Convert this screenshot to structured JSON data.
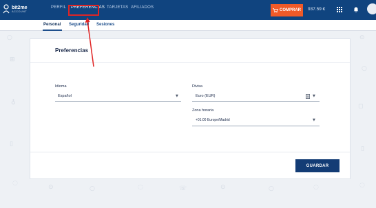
{
  "brand": {
    "name": "bit2me",
    "sub": "ACCOUNT"
  },
  "nav": {
    "items": [
      {
        "label": "PERFIL",
        "active": false
      },
      {
        "label": "PREFERENCIAS",
        "active": true
      },
      {
        "label": "TARJETAS",
        "active": false
      },
      {
        "label": "AFILIADOS",
        "active": false
      }
    ],
    "buy_label": "COMPRAR",
    "balance": "937.59 €"
  },
  "subtabs": [
    {
      "label": "Personal",
      "active": true
    },
    {
      "label": "Seguridad",
      "active": false
    },
    {
      "label": "Sesiones",
      "active": false
    }
  ],
  "card": {
    "title": "Preferencias",
    "idioma": {
      "label": "Idioma",
      "value": "Español"
    },
    "divisa": {
      "label": "Divisa",
      "value": "Euro (EUR)"
    },
    "zona": {
      "label": "Zona horaria",
      "value": "+01:00 Europe/Madrid"
    },
    "save_label": "GUARDAR"
  },
  "colors": {
    "navbar": "#10447f",
    "buy": "#f05a28",
    "save": "#133c75",
    "annotation": "#e02424"
  }
}
